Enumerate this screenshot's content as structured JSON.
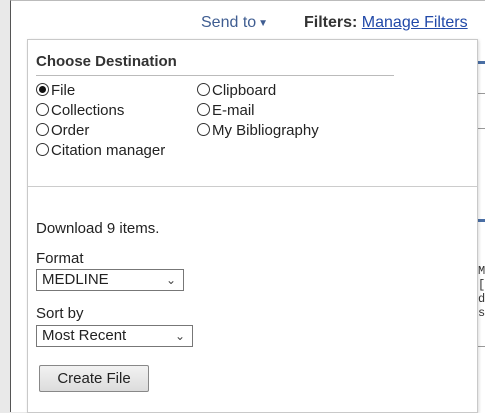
{
  "header": {
    "send_to_label": "Send to",
    "filters_label": "Filters:",
    "manage_filters_link": "Manage Filters"
  },
  "background_text": [
    "Mc",
    "[A",
    "da",
    "s"
  ],
  "panel": {
    "title": "Choose Destination",
    "destinations": [
      {
        "label": "File",
        "selected": true
      },
      {
        "label": "Clipboard",
        "selected": false
      },
      {
        "label": "Collections",
        "selected": false
      },
      {
        "label": "E-mail",
        "selected": false
      },
      {
        "label": "Order",
        "selected": false
      },
      {
        "label": "My Bibliography",
        "selected": false
      },
      {
        "label": "Citation manager",
        "selected": false
      }
    ],
    "download_text": "Download 9 items.",
    "format_label": "Format",
    "format_value": "MEDLINE",
    "sort_label": "Sort by",
    "sort_value": "Most Recent",
    "create_button": "Create File"
  },
  "colors": {
    "link": "#2149a8",
    "send_to": "#3f5d91"
  }
}
